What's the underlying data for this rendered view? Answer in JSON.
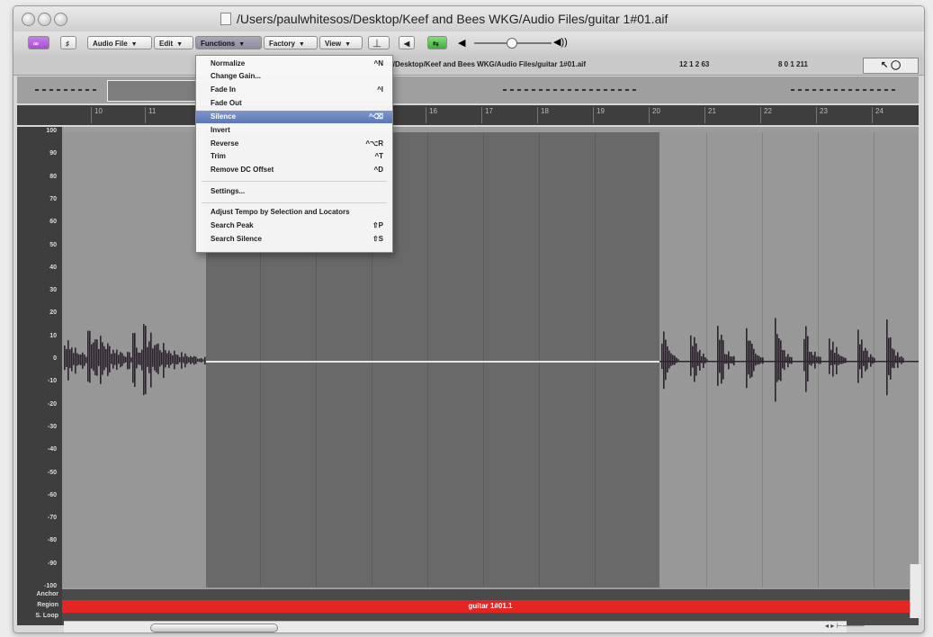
{
  "window": {
    "title": "/Users/paulwhitesos/Desktop/Keef and Bees WKG/Audio Files/guitar 1#01.aif"
  },
  "toolbar": {
    "audio_file": "Audio File",
    "edit": "Edit",
    "functions": "Functions",
    "factory": "Factory",
    "view": "View"
  },
  "infobar": {
    "path": "sos/Desktop/Keef and Bees WKG/Audio Files/guitar 1#01.aif",
    "position1": "12  1  2  63",
    "position2": "8  0  1 211",
    "tool": "↖ ◯"
  },
  "ruler": {
    "ticks": [
      "10",
      "11",
      "16",
      "17",
      "18",
      "19",
      "20",
      "21",
      "22",
      "23",
      "24"
    ]
  },
  "y_axis": [
    "100",
    "90",
    "80",
    "70",
    "60",
    "50",
    "40",
    "30",
    "20",
    "10",
    "0",
    "-10",
    "-20",
    "-30",
    "-40",
    "-50",
    "-60",
    "-70",
    "-80",
    "-90",
    "-100"
  ],
  "lanes": {
    "anchor": "Anchor",
    "region": "Region",
    "loop": "S. Loop"
  },
  "region_name": "guitar 1#01.1",
  "functions_menu": {
    "items": [
      {
        "label": "Normalize",
        "shortcut": "^N"
      },
      {
        "label": "Change Gain...",
        "shortcut": ""
      },
      {
        "label": "Fade In",
        "shortcut": "^I"
      },
      {
        "label": "Fade Out",
        "shortcut": ""
      },
      {
        "label": "Silence",
        "shortcut": "^⌫"
      },
      {
        "label": "Invert",
        "shortcut": ""
      },
      {
        "label": "Reverse",
        "shortcut": "^⌥R"
      },
      {
        "label": "Trim",
        "shortcut": "^T"
      },
      {
        "label": "Remove DC Offset",
        "shortcut": "^D"
      },
      {
        "label": "Settings...",
        "shortcut": ""
      },
      {
        "label": "Adjust Tempo by Selection and Locators",
        "shortcut": ""
      },
      {
        "label": "Search Peak",
        "shortcut": "⇧P"
      },
      {
        "label": "Search Silence",
        "shortcut": "⇧S"
      }
    ],
    "highlighted": "Silence"
  },
  "colors": {
    "region": "#e52424",
    "selection": "#696969",
    "waveform": "#2e2230",
    "highlight": "#5c77b6"
  }
}
